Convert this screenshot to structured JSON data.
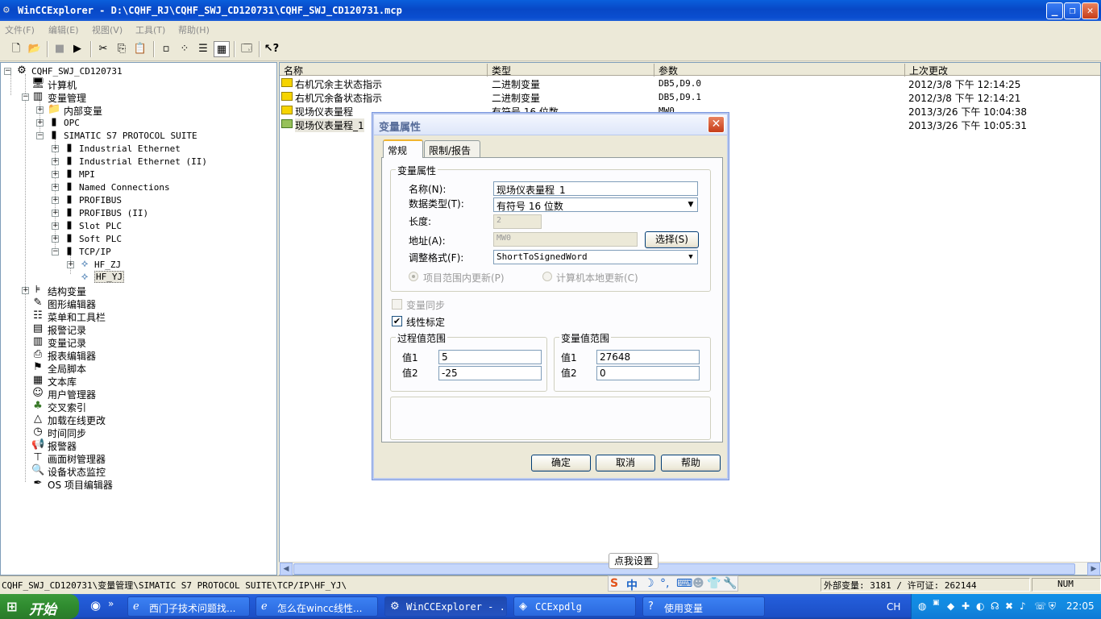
{
  "window": {
    "title": "WinCCExplorer - D:\\CQHF_RJ\\CQHF_SWJ_CD120731\\CQHF_SWJ_CD120731.mcp",
    "minimize": "_",
    "maximize": "❐",
    "close": "✕"
  },
  "menu": {
    "file": "文件(F)",
    "edit": "编辑(E)",
    "view": "视图(V)",
    "tools": "工具(T)",
    "help": "帮助(H)"
  },
  "tree": {
    "root": "CQHF_SWJ_CD120731",
    "computer": "计算机",
    "tag_mgmt": "变量管理",
    "internal_tags": "内部变量",
    "opc": "OPC",
    "simatic": "SIMATIC S7 PROTOCOL SUITE",
    "ie": "Industrial Ethernet",
    "ie2": "Industrial Ethernet (II)",
    "mpi": "MPI",
    "named": "Named Connections",
    "profibus": "PROFIBUS",
    "profibus2": "PROFIBUS (II)",
    "slot_plc": "Slot PLC",
    "soft_plc": "Soft PLC",
    "tcpip": "TCP/IP",
    "hf_zj": "HF_ZJ",
    "hf_yj": "HF_YJ",
    "struct_tags": "结构变量",
    "graphics": "图形编辑器",
    "menus": "菜单和工具栏",
    "alarm_log": "报警记录",
    "tag_log": "变量记录",
    "report": "报表编辑器",
    "global_script": "全局脚本",
    "text_lib": "文本库",
    "user_admin": "用户管理器",
    "cross_ref": "交叉索引",
    "online_change": "加载在线更改",
    "time_sync": "时间同步",
    "horn": "报警器",
    "pic_tree": "画面树管理器",
    "lifebeat": "设备状态监控",
    "os_editor": "OS 项目编辑器"
  },
  "list": {
    "headers": {
      "name": "名称",
      "type": "类型",
      "param": "参数",
      "changed": "上次更改"
    },
    "rows": [
      {
        "name": "右机冗余主状态指示",
        "type": "二进制变量",
        "param": "DB5,D9.0",
        "changed": "2012/3/8 下午 12:14:25"
      },
      {
        "name": "右机冗余备状态指示",
        "type": "二进制变量",
        "param": "DB5,D9.1",
        "changed": "2012/3/8 下午 12:14:21"
      },
      {
        "name": "现场仪表量程",
        "type": "有符号 16 位数",
        "param": "MW0",
        "changed": "2013/3/26 下午 10:04:38"
      },
      {
        "name": "现场仪表量程_1",
        "type": "",
        "param": "",
        "changed": "2013/3/26 下午 10:05:31"
      }
    ]
  },
  "dialog": {
    "title": "变量属性",
    "tab_general": "常规",
    "tab_limits": "限制/报告",
    "group_props": "变量属性",
    "name_label": "名称(N):",
    "name_value": "现场仪表量程_1",
    "datatype_label": "数据类型(T):",
    "datatype_value": "有符号 16 位数",
    "length_label": "长度:",
    "length_value": "2",
    "address_label": "地址(A):",
    "address_value": "MW0",
    "select_button": "选择(S)",
    "adapt_label": "调整格式(F):",
    "adapt_value": "ShortToSignedWord",
    "radio_project": "项目范围内更新(P)",
    "radio_local": "计算机本地更新(C)",
    "sync_label": "变量同步",
    "linear_label": "线性标定",
    "process_range": "过程值范围",
    "tag_range": "变量值范围",
    "value1": "值1",
    "value2": "值2",
    "proc_v1": "5",
    "proc_v2": "-25",
    "tag_v1": "27648",
    "tag_v2": "0",
    "ok": "确定",
    "cancel": "取消",
    "help": "帮助"
  },
  "statusbar": {
    "path": "CQHF_SWJ_CD120731\\变量管理\\SIMATIC S7 PROTOCOL SUITE\\TCP/IP\\HF_YJ\\",
    "tags": "外部变量: 3181 / 许可证: 262144",
    "num": "NUM"
  },
  "ime": {
    "tip": "点我设置",
    "zh": "中"
  },
  "taskbar": {
    "start": "开始",
    "tasks": [
      "西门子技术问题找...",
      "怎么在wincc线性...",
      "WinCCExplorer - ...",
      "CCExpdlg",
      "使用变量"
    ],
    "lang": "CH",
    "clock": "22:05"
  }
}
